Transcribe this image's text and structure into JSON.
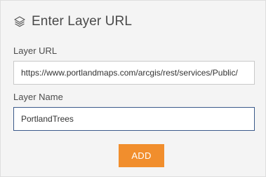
{
  "header": {
    "title": "Enter Layer URL",
    "icon": "layers-icon"
  },
  "form": {
    "layer_url": {
      "label": "Layer URL",
      "value": "https://www.portlandmaps.com/arcgis/rest/services/Public/"
    },
    "layer_name": {
      "label": "Layer Name",
      "value": "PortlandTrees"
    },
    "add_button_label": "ADD"
  },
  "colors": {
    "accent": "#f18e2d",
    "focus_border": "#3b5a8a"
  }
}
